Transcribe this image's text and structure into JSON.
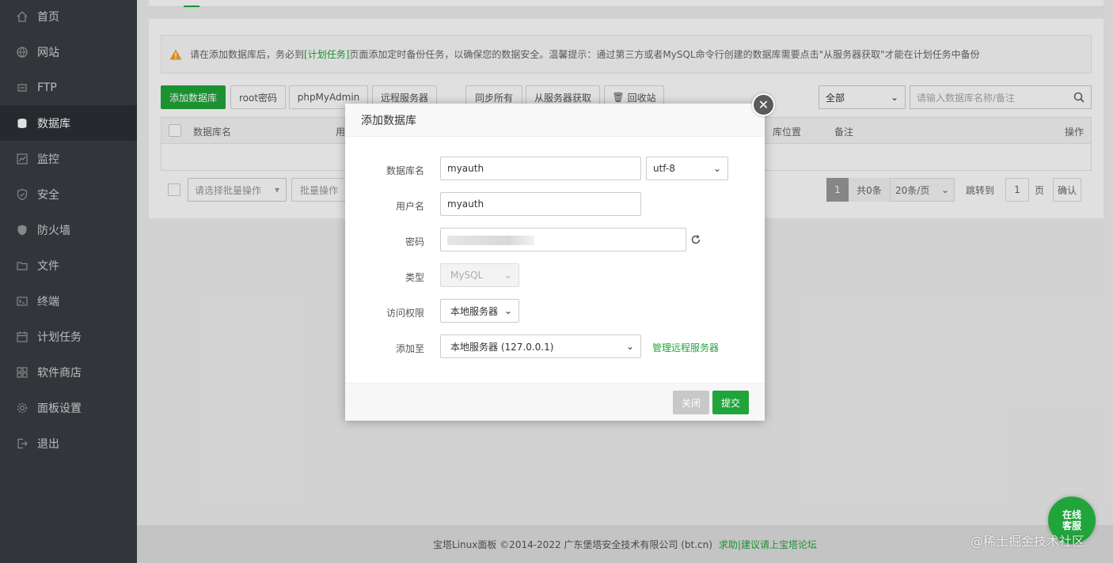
{
  "sidebar": {
    "items": [
      {
        "label": "首页",
        "icon": "home-icon"
      },
      {
        "label": "网站",
        "icon": "globe-icon"
      },
      {
        "label": "FTP",
        "icon": "ftp-icon"
      },
      {
        "label": "数据库",
        "icon": "database-icon",
        "active": true
      },
      {
        "label": "监控",
        "icon": "monitor-icon"
      },
      {
        "label": "安全",
        "icon": "shield-icon"
      },
      {
        "label": "防火墙",
        "icon": "firewall-icon"
      },
      {
        "label": "文件",
        "icon": "folder-icon"
      },
      {
        "label": "终端",
        "icon": "terminal-icon"
      },
      {
        "label": "计划任务",
        "icon": "calendar-icon"
      },
      {
        "label": "软件商店",
        "icon": "apps-icon"
      },
      {
        "label": "面板设置",
        "icon": "gear-icon"
      },
      {
        "label": "退出",
        "icon": "logout-icon"
      }
    ]
  },
  "notice": {
    "before": "请在添加数据库后，务必到",
    "link": "[计划任务]",
    "after": "页面添加定时备份任务，以确保您的数据安全。温馨提示：通过第三方或者MySQL命令行创建的数据库需要点击\"从服务器获取\"才能在计划任务中备份"
  },
  "toolbar": {
    "add_db": "添加数据库",
    "root_pwd": "root密码",
    "phpmyadmin": "phpMyAdmin",
    "remote_server": "远程服务器",
    "sync_all": "同步所有",
    "fetch_from_server": "从服务器获取",
    "recycle_bin": "回收站",
    "filter_value": "全部",
    "search_placeholder": "请输入数据库名称/备注"
  },
  "table": {
    "headers": {
      "name": "数据库名",
      "user": "用",
      "location": "库位置",
      "remark": "备注",
      "action": "操作"
    }
  },
  "batch": {
    "select_placeholder": "请选择批量操作",
    "batch_btn": "批量操作"
  },
  "pager": {
    "current": "1",
    "total": "共0条",
    "per_page": "20条/页",
    "jump_label": "跳转到",
    "jump_value": "1",
    "page_unit": "页",
    "confirm": "确认"
  },
  "modal": {
    "title": "添加数据库",
    "fields": {
      "db_name_label": "数据库名",
      "db_name_value": "myauth",
      "charset_value": "utf-8",
      "username_label": "用户名",
      "username_value": "myauth",
      "password_label": "密码",
      "type_label": "类型",
      "type_value": "MySQL",
      "access_label": "访问权限",
      "access_value": "本地服务器",
      "add_to_label": "添加至",
      "add_to_value": "本地服务器 (127.0.0.1)",
      "manage_remote": "管理远程服务器"
    },
    "close_btn": "关闭",
    "submit_btn": "提交"
  },
  "footer": {
    "copyright": "宝塔Linux面板 ©2014-2022 广东堡塔安全技术有限公司 (bt.cn)",
    "help_link": "求助|建议请上宝塔论坛"
  },
  "chat": {
    "line1": "在线",
    "line2": "客服"
  },
  "watermark": "@稀土掘金技术社区",
  "colors": {
    "accent": "#20a53a",
    "sidebar": "#3a3e44"
  }
}
